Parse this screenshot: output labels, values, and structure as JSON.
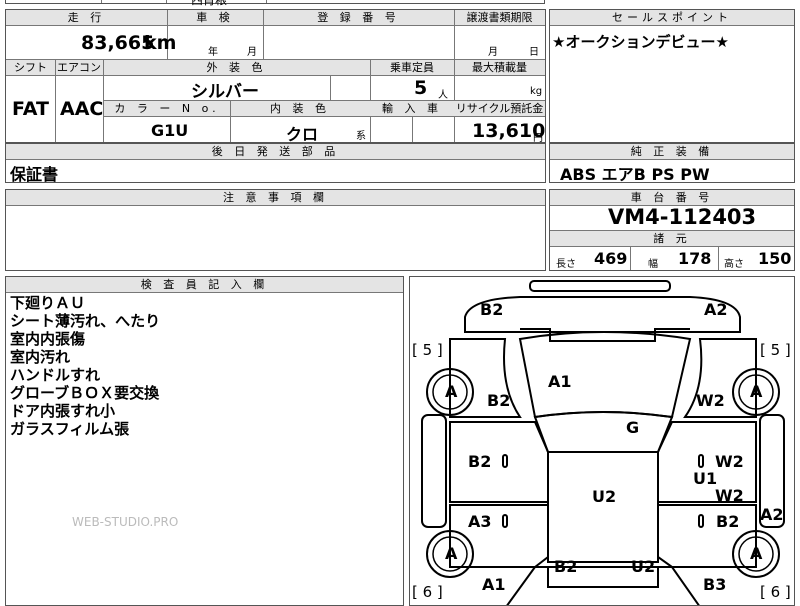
{
  "top_partial": {
    "text": "西肖粮"
  },
  "mileage": {
    "header": "走 行",
    "value": "83,665",
    "unit": "km"
  },
  "inspection": {
    "header": "車 検",
    "year_unit": "年",
    "month_unit": "月"
  },
  "registration": {
    "header": "登 録 番 号"
  },
  "transfer_deadline": {
    "header": "譲渡書類期限",
    "month_unit": "月",
    "day_unit": "日"
  },
  "sale_points": {
    "header": "セールスポイント",
    "text": "★オークションデビュー★"
  },
  "shift": {
    "header": "シフト",
    "value": "FAT"
  },
  "aircon": {
    "header": "エアコン",
    "value": "AAC"
  },
  "exterior_color": {
    "header": "外 装 色",
    "value": "シルバー"
  },
  "capacity": {
    "header": "乗車定員",
    "value": "5",
    "unit": "人"
  },
  "max_load": {
    "header": "最大積載量",
    "unit": "kg"
  },
  "color_no": {
    "header": "カ ラ ー N o.",
    "value": "G1U"
  },
  "interior_color": {
    "header": "内 装 色",
    "value": "クロ",
    "suffix": "系"
  },
  "import": {
    "header": "輸 入 車"
  },
  "recycle": {
    "header": "リサイクル預託金",
    "value": "13,610",
    "unit": "円"
  },
  "later_parts": {
    "header": "後 日 発 送 部 品",
    "value": "保証書"
  },
  "genuine_equipment": {
    "header": "純 正 装 備",
    "value": "ABS エアB PS PW"
  },
  "caution": {
    "header": "注 意 事 項 欄"
  },
  "chassis": {
    "header": "車 台 番 号",
    "value": "VM4-112403"
  },
  "specs": {
    "header": "諸 元",
    "length_label": "長さ",
    "length": "469",
    "width_label": "幅",
    "width": "178",
    "height_label": "高さ",
    "height": "150"
  },
  "inspector": {
    "header": "検 査 員 記 入 欄",
    "notes": [
      "下廻りＡＵ",
      "シート薄汚れ、へたり",
      "室内内張傷",
      "室内汚れ",
      "ハンドルすれ",
      "グローブＢＯＸ要交換",
      "ドア内張すれ小",
      "ガラスフィルム張"
    ],
    "watermark": "WEB-STUDIO.PRO"
  },
  "diagram": {
    "tire_label": "A",
    "tire_depth_front": "[ 5 ]",
    "tire_depth_rear": "[ 6 ]",
    "marks": {
      "front_left_bumper": "B2",
      "front_right_bumper": "A2",
      "hood": "A1",
      "left_fender": "B2",
      "right_fender": "W2",
      "roof": "G",
      "left_front_door": "B2",
      "right_front_door": "W2",
      "right_sill": "U1",
      "right_rear_door": "W2",
      "left_rear_door": "A3",
      "right_rear_door_low": "B2",
      "right_quarter": "A2",
      "floor": "U2",
      "trunk_left": "B2",
      "trunk_right": "U2",
      "rear_left": "A1",
      "rear_right": "B3"
    }
  }
}
